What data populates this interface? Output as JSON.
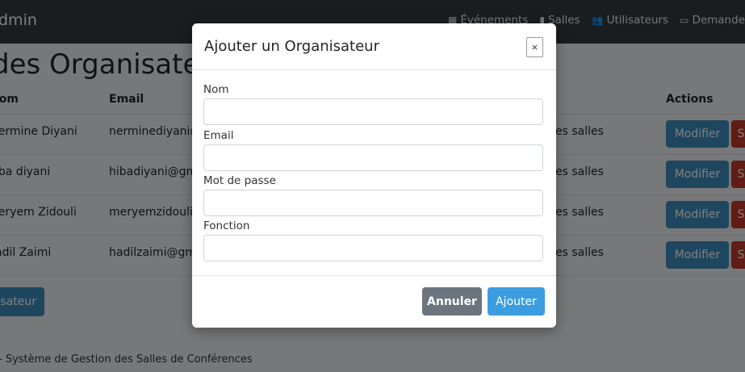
{
  "navbar": {
    "brand": "dmin",
    "links": [
      {
        "icon": "calendar-icon",
        "glyph": "▦",
        "label": "Événements"
      },
      {
        "icon": "building-icon",
        "glyph": "▮",
        "label": "Salles"
      },
      {
        "icon": "users-icon",
        "glyph": "👥",
        "label": "Utilisateurs"
      },
      {
        "icon": "inbox-icon",
        "glyph": "▭",
        "label": "Demande"
      }
    ]
  },
  "page": {
    "title": "des Organisateurs",
    "table": {
      "headers": {
        "nom": "lom",
        "email": "Email",
        "actions": "Actions"
      },
      "rows": [
        {
          "nom": "lermine Diyani",
          "email": "nerminediyani@",
          "fonction": "es salles"
        },
        {
          "nom": "iba diyani",
          "email": "hibadiyani@gma",
          "fonction": "es salles"
        },
        {
          "nom": "leryem Zidouli",
          "email": "meryemzidoulii@",
          "fonction": "es salles"
        },
        {
          "nom": "adil Zaimi",
          "email": "hadilzaimi@gma",
          "fonction": "es salles"
        }
      ],
      "modifier_label": "Modifier",
      "supprimer_label": "S"
    },
    "add_button_label": "isateur",
    "footer": "- Système de Gestion des Salles de Conférences"
  },
  "modal": {
    "title": "Ajouter un Organisateur",
    "close_label": "×",
    "fields": [
      {
        "label": "Nom",
        "value": ""
      },
      {
        "label": "Email",
        "value": ""
      },
      {
        "label": "Mot de passe",
        "value": ""
      },
      {
        "label": "Fonction",
        "value": ""
      }
    ],
    "cancel_label": "Annuler",
    "submit_label": "Ajouter"
  }
}
